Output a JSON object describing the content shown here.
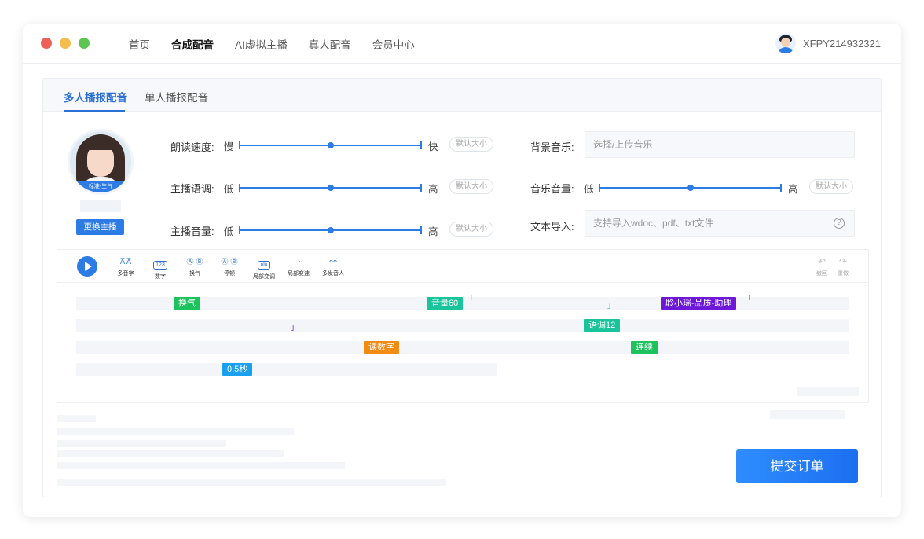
{
  "nav": {
    "items": [
      {
        "label": "首页",
        "active": false
      },
      {
        "label": "合成配音",
        "active": true
      },
      {
        "label": "AI虚拟主播",
        "active": false
      },
      {
        "label": "真人配音",
        "active": false
      },
      {
        "label": "会员中心",
        "active": false
      }
    ]
  },
  "user": {
    "name": "XFPY214932321"
  },
  "tabs": [
    {
      "label": "多人播报配音",
      "active": true
    },
    {
      "label": "单人播报配音",
      "active": false
    }
  ],
  "anchor": {
    "badge": "标准-生气",
    "change_label": "更换主播"
  },
  "params": {
    "speed": {
      "label": "朗读速度:",
      "low": "慢",
      "high": "快",
      "value": 0.5,
      "default_label": "默认大小"
    },
    "pitch": {
      "label": "主播语调:",
      "low": "低",
      "high": "高",
      "value": 0.5,
      "default_label": "默认大小"
    },
    "volume": {
      "label": "主播音量:",
      "low": "低",
      "high": "高",
      "value": 0.5,
      "default_label": "默认大小"
    },
    "bgm": {
      "label": "背景音乐:",
      "placeholder": "选择/上传音乐"
    },
    "music_volume": {
      "label": "音乐音量:",
      "low": "低",
      "high": "高",
      "value": 0.5,
      "default_label": "默认大小"
    },
    "text_import": {
      "label": "文本导入:",
      "placeholder": "支持导入wdoc、pdf、txt文件",
      "help": "?"
    }
  },
  "toolbar": {
    "tools": [
      {
        "icon": "A̅ A̅",
        "label": "多音字"
      },
      {
        "icon": "123",
        "label": "数字"
      },
      {
        "icon": "Ⓐ·Ⓑ",
        "label": "换气"
      },
      {
        "icon": "Ⓐ·Ⓑ",
        "label": "停顿"
      },
      {
        "icon": "ıılıı",
        "label": "局部变调"
      },
      {
        "icon": "◔",
        "label": "局部变速"
      },
      {
        "icon": "ᴖᴖ",
        "label": "多发音人"
      }
    ],
    "undo_label": "撤回",
    "redo_label": "重做",
    "undo_icon": "↶",
    "redo_icon": "↷"
  },
  "editor_tags": {
    "breath": "换气",
    "volume": "音量60",
    "speaker": "聆小瑶-品质-助理",
    "pitch": "语调12",
    "read_number": "读数字",
    "liaison": "连续",
    "pause": "0.5秒",
    "bracket_open": "「",
    "bracket_close": "」"
  },
  "submit_label": "提交订单"
}
